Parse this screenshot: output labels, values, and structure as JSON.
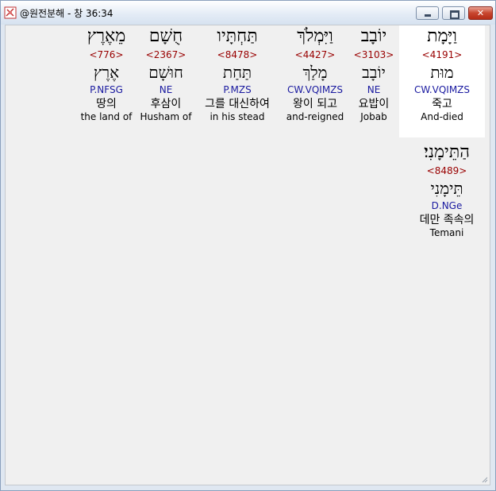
{
  "window": {
    "title": "@원전분해 - 창 36:34",
    "icon": "app-icon"
  },
  "words": [
    {
      "hebrew": "וַיָּמָת",
      "strong": "<4191>",
      "lemma": "מוּת",
      "parse": "CW.VQIMZS",
      "korean": "죽고",
      "english": "And-died",
      "selected": true
    },
    {
      "hebrew": "יוֹבָב",
      "strong": "<3103>",
      "lemma": "יוֹבָב",
      "parse": "NE",
      "korean": "요밥이",
      "english": "Jobab",
      "selected": false
    },
    {
      "hebrew": "וַיִּמְלֹךְ",
      "strong": "<4427>",
      "lemma": "מָלַךְ",
      "parse": "CW.VQIMZS",
      "korean": "왕이 되고",
      "english": "and-reigned",
      "selected": false
    },
    {
      "hebrew": "תַּחְתָּיו",
      "strong": "<8478>",
      "lemma": "תַּחַת",
      "parse": "P.MZS",
      "korean": "그를 대신하여",
      "english": "in his stead",
      "selected": false
    },
    {
      "hebrew": "חֻשָׁם",
      "strong": "<2367>",
      "lemma": "חוּשָׁם",
      "parse": "NE",
      "korean": "후삼이",
      "english": "Husham of",
      "selected": false
    },
    {
      "hebrew": "מֵאֶרֶץ",
      "strong": "<776>",
      "lemma": "אֶרֶץ",
      "parse": "P.NFSG",
      "korean": "땅의",
      "english": "the land of",
      "selected": false
    },
    {
      "hebrew": "הַתֵּימָנִי׃",
      "strong": "<8489>",
      "lemma": "תֵּימָנִי",
      "parse": "D.NGe",
      "korean": "데만 족속의",
      "english": "Temani",
      "selected": false
    }
  ]
}
